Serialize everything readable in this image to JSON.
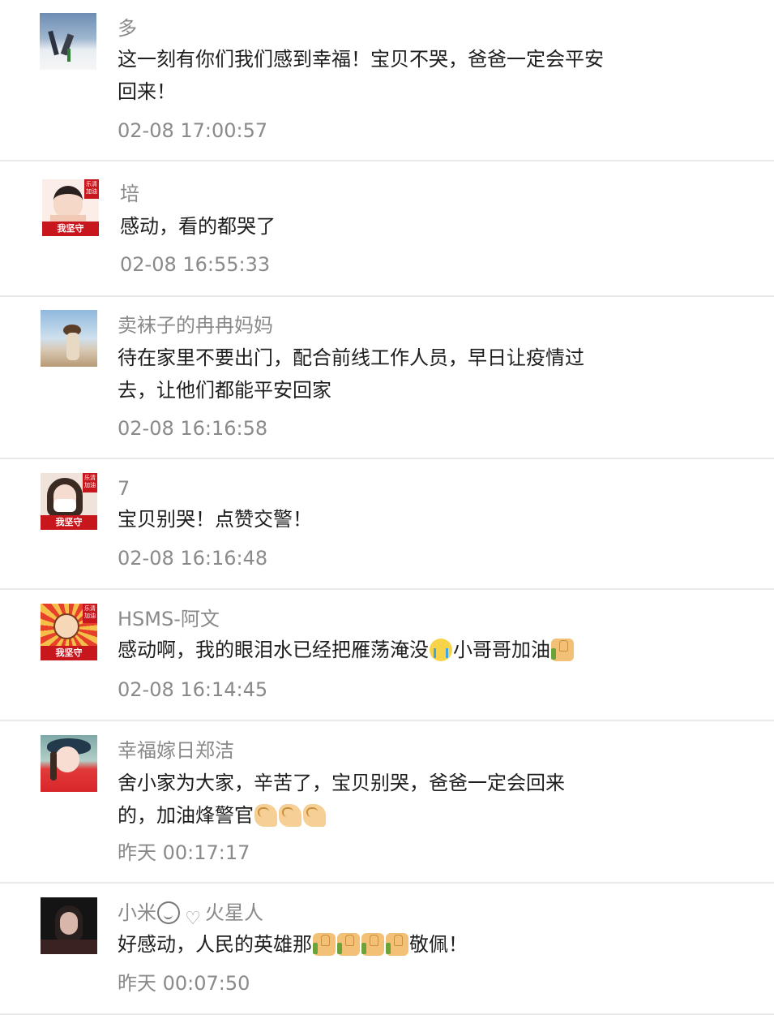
{
  "comments": [
    {
      "name": "多",
      "text": "这一刻有你们我们感到幸福！宝贝不哭，爸爸一定会平安回来！",
      "time": "02-08 17:00:57"
    },
    {
      "name": "培",
      "text": "感动，看的都哭了",
      "time": "02-08 16:55:33",
      "badge": "我坚守",
      "corner": "乐清加油"
    },
    {
      "name": "卖袜子的冉冉妈妈",
      "text": "待在家里不要出门，配合前线工作人员，早日让疫情过去，让他们都能平安回家",
      "time": "02-08 16:16:58"
    },
    {
      "name": "7",
      "text": "宝贝别哭！点赞交警！",
      "time": "02-08 16:16:48",
      "badge": "我坚守",
      "corner": "乐清加油"
    },
    {
      "name": "HSMS-阿文",
      "text_parts": [
        "感动啊，我的眼泪水已经把雁荡淹没",
        "小哥哥加油"
      ],
      "time": "02-08 16:14:45",
      "badge": "我坚守",
      "corner": "乐清加油"
    },
    {
      "name": "幸福嫁日郑洁",
      "text_parts": [
        "舍小家为大家，辛苦了，宝贝别哭，爸爸一定会回来的，加油烽警官"
      ],
      "time": "昨天 00:17:17"
    },
    {
      "name_parts": [
        "小米",
        "火星人"
      ],
      "text_parts": [
        "好感动，人民的英雄那",
        "敬佩！"
      ],
      "time": "昨天 00:07:50"
    }
  ],
  "icons": {
    "thumb": "thumbs-up-icon",
    "muscle": "flexed-biceps-icon",
    "cry": "crying-face-icon",
    "wink": "winking-face-icon",
    "heart": "heart-icon"
  },
  "colors": {
    "name": "#8a8a8a",
    "text": "#1e1e1e",
    "divider": "#e9e9e9",
    "badge": "#c8161d"
  }
}
